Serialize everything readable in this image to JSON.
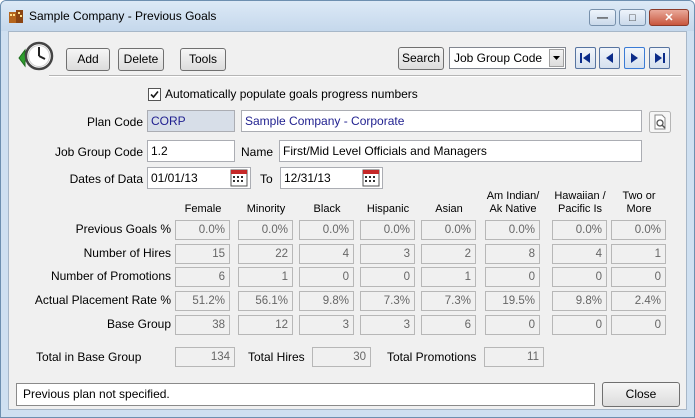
{
  "window": {
    "title": "Sample Company - Previous Goals"
  },
  "toolbar": {
    "add_label": "Add",
    "delete_label": "Delete",
    "tools_label": "Tools",
    "search_label": "Search",
    "search_field": "Job Group Code"
  },
  "form": {
    "auto_populate_label": "Automatically populate goals progress numbers",
    "auto_populate_checked": true,
    "plan_code_label": "Plan Code",
    "plan_code_value": "CORP",
    "plan_name_value": "Sample Company - Corporate",
    "job_group_label": "Job Group Code",
    "job_group_value": "1.2",
    "name_label": "Name",
    "name_value": "First/Mid Level Officials and Managers",
    "dates_label": "Dates of Data",
    "date_from": "01/01/13",
    "to_label": "To",
    "date_to": "12/31/13"
  },
  "grid": {
    "columns": [
      "Female",
      "Minority",
      "Black",
      "Hispanic",
      "Asian",
      "Am Indian/\nAk Native",
      "Hawaiian /\nPacific Is",
      "Two or\nMore"
    ],
    "rows": [
      {
        "label": "Previous Goals %",
        "values": [
          "0.0%",
          "0.0%",
          "0.0%",
          "0.0%",
          "0.0%",
          "0.0%",
          "0.0%",
          "0.0%"
        ]
      },
      {
        "label": "Number of Hires",
        "values": [
          "15",
          "22",
          "4",
          "3",
          "2",
          "8",
          "4",
          "1"
        ]
      },
      {
        "label": "Number of Promotions",
        "values": [
          "6",
          "1",
          "0",
          "0",
          "1",
          "0",
          "0",
          "0"
        ]
      },
      {
        "label": "Actual Placement Rate %",
        "values": [
          "51.2%",
          "56.1%",
          "9.8%",
          "7.3%",
          "7.3%",
          "19.5%",
          "9.8%",
          "2.4%"
        ]
      },
      {
        "label": "Base Group",
        "values": [
          "38",
          "12",
          "3",
          "3",
          "6",
          "0",
          "0",
          "0"
        ]
      }
    ]
  },
  "totals": {
    "base_group_label": "Total in Base Group",
    "base_group_value": "134",
    "hires_label": "Total Hires",
    "hires_value": "30",
    "promotions_label": "Total Promotions",
    "promotions_value": "11"
  },
  "status": {
    "message": "Previous plan not specified."
  },
  "footer": {
    "close_label": "Close"
  },
  "icons": {
    "app": "building-icon",
    "clock": "clock-arrow-icon",
    "lookup": "lookup-icon",
    "calendar": "calendar-icon"
  }
}
